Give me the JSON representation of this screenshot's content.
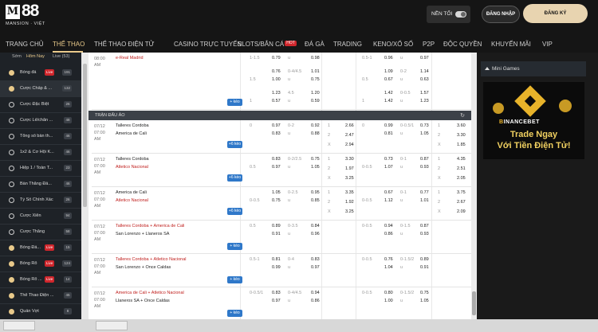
{
  "logo": {
    "mark": "M",
    "number": "88",
    "sub": "MANSION · VIỆT"
  },
  "header": {
    "night_label": "NỀN TỐI",
    "login_label": "ĐĂNG NHẬP",
    "register_label": "ĐĂNG KÝ"
  },
  "nav": {
    "items": [
      {
        "label": "TRANG CHỦ"
      },
      {
        "label": "THỂ THAO"
      },
      {
        "label": "THỂ THAO ĐIỆN TỬ"
      },
      {
        "label": "CASINO TRỰC TUYẾN"
      },
      {
        "label": "SLOTS/BẮN CÁ"
      },
      {
        "label": "ĐÁ GÀ"
      },
      {
        "label": "TRADING"
      },
      {
        "label": "KENO/XỔ SỐ"
      },
      {
        "label": "P2P"
      },
      {
        "label": "ĐỘC QUYỀN"
      },
      {
        "label": "KHUYẾN MÃI"
      },
      {
        "label": "VIP"
      }
    ],
    "hot_badge": "HOT",
    "active": "THỂ THAO"
  },
  "sidebar": {
    "tabs": [
      "Sớm",
      "Hôm Nay",
      "Live (53)"
    ],
    "items": [
      {
        "label": "Bóng đá",
        "live": "Live",
        "count": "191",
        "icon": "soccer-ball-icon"
      },
      {
        "label": "Cược Chấp & ...",
        "count": "132",
        "icon": "soccer-ball-icon"
      },
      {
        "label": "Cược Đặc Biệt",
        "count": "26",
        "icon": "circle-icon"
      },
      {
        "label": "Cược Lẻ/chẵn ...",
        "count": "48",
        "icon": "circle-icon"
      },
      {
        "label": "Tổng số bàn th...",
        "count": "46",
        "icon": "circle-icon"
      },
      {
        "label": "1x2 & Cơ Hội K...",
        "count": "46",
        "icon": "circle-icon"
      },
      {
        "label": "Hiệp 1 / Toàn T...",
        "count": "23",
        "icon": "circle-icon"
      },
      {
        "label": "Bàn Thắng Đầ...",
        "count": "46",
        "icon": "circle-icon"
      },
      {
        "label": "Tỷ Số Chính Xác",
        "count": "26",
        "icon": "circle-icon"
      },
      {
        "label": "Cược Xiên",
        "count": "94",
        "icon": "circle-icon"
      },
      {
        "label": "Cược Thắng",
        "count": "58",
        "icon": "circle-icon"
      },
      {
        "label": "Bóng Đá...",
        "live": "Live",
        "count": "15",
        "icon": "soccer-ball-icon"
      },
      {
        "label": "Bóng Rổ",
        "live": "Live",
        "count": "124",
        "icon": "basketball-icon"
      },
      {
        "label": "Bóng Rổ ...",
        "live": "Live",
        "count": "14",
        "icon": "basketball-icon"
      },
      {
        "label": "Thể Thao Điện ...",
        "count": "45",
        "icon": "esports-icon"
      },
      {
        "label": "Quần Vợt",
        "count": "8",
        "icon": "tennis-icon"
      }
    ]
  },
  "main": {
    "section_label": "TRẬN ĐẤU ẢO",
    "more_label": "+ kèo",
    "top_row": {
      "time": "08:00",
      "ampm": "AM",
      "team": "e-Real Madrid",
      "l1": [
        [
          "1-1.5",
          "0.79",
          "u",
          "0.98"
        ],
        [
          "",
          "0.76",
          "0-4/4.5",
          "1.01"
        ],
        [
          "1.5",
          "1.00",
          "u",
          "0.75"
        ],
        [
          "",
          "1.23",
          "4.5",
          "1.20"
        ],
        [
          "1",
          "0.57",
          "u",
          "0.59"
        ]
      ],
      "r1": [
        [
          "0.5-1",
          "0.96",
          "u",
          "0.97"
        ],
        [
          "",
          "1.09",
          "0-2",
          "1.14"
        ],
        [
          "0.5",
          "0.67",
          "u",
          "0.63"
        ],
        [
          "",
          "1.42",
          "0-0.5",
          "1.57"
        ],
        [
          "1",
          "1.42",
          "u",
          "1.23"
        ]
      ]
    },
    "matches": [
      {
        "date": "07/12",
        "time": "07:00",
        "ampm": "AM",
        "home": "Talleres Cordoba",
        "away": "America de Cali",
        "home_red": false,
        "away_red": false,
        "more": "+6 kèo",
        "hdp": [
          "0",
          "0.97",
          "0-2",
          "0.92"
        ],
        "hdp2": [
          "",
          "0.83",
          "u",
          "0.88"
        ],
        "x12": [
          [
            "1",
            "2.66"
          ],
          [
            "2",
            "2.47"
          ],
          [
            "X",
            "2.94"
          ]
        ],
        "hhdp": [
          "0",
          "0.99",
          "0-0.5/1",
          "0.73"
        ],
        "hhdp2": [
          "",
          "0.81",
          "u",
          "1.05"
        ],
        "hx12": [
          [
            "1",
            "3.60"
          ],
          [
            "2",
            "3.30"
          ],
          [
            "X",
            "1.85"
          ]
        ]
      },
      {
        "date": "07/12",
        "time": "07:00",
        "ampm": "AM",
        "home": "Talleres Cordoba",
        "away": "Atletico Nacional",
        "home_red": false,
        "away_red": true,
        "more": "+6 kèo",
        "hdp": [
          "",
          "0.83",
          "0-2/2.5",
          "0.75"
        ],
        "hdp2": [
          "0.5",
          "0.97",
          "u",
          "1.05"
        ],
        "x12": [
          [
            "1",
            "3.30"
          ],
          [
            "2",
            "1.97"
          ],
          [
            "X",
            "3.25"
          ]
        ],
        "hhdp": [
          "",
          "0.73",
          "0-1",
          "0.87"
        ],
        "hhdp2": [
          "0-0.5",
          "1.07",
          "u",
          "0.93"
        ],
        "hx12": [
          [
            "1",
            "4.35"
          ],
          [
            "2",
            "2.51"
          ],
          [
            "X",
            "2.05"
          ]
        ]
      },
      {
        "date": "07/12",
        "time": "07:00",
        "ampm": "AM",
        "home": "America de Cali",
        "away": "Atletico Nacional",
        "home_red": false,
        "away_red": true,
        "more": "+6 kèo",
        "hdp": [
          "",
          "1.05",
          "0-2.5",
          "0.95"
        ],
        "hdp2": [
          "0-0.5",
          "0.75",
          "u",
          "0.85"
        ],
        "x12": [
          [
            "1",
            "3.35"
          ],
          [
            "2",
            "1.92"
          ],
          [
            "X",
            "3.25"
          ]
        ],
        "hhdp": [
          "",
          "0.67",
          "0-1",
          "0.77"
        ],
        "hhdp2": [
          "0-0.5",
          "1.12",
          "u",
          "1.01"
        ],
        "hx12": [
          [
            "1",
            "3.75"
          ],
          [
            "2",
            "2.67"
          ],
          [
            "X",
            "2.09"
          ]
        ]
      },
      {
        "date": "07/12",
        "time": "07:00",
        "ampm": "AM",
        "home": "Talleres Cordoba + America de Cali",
        "away": "San Lorenzo + Llaneros SA",
        "home_red": true,
        "away_red": false,
        "more": "+ kèo",
        "hdp": [
          "0.5",
          "0.89",
          "0-3.5",
          "0.84"
        ],
        "hdp2": [
          "",
          "0.91",
          "u",
          "0.96"
        ],
        "x12": [],
        "hhdp": [
          "0-0.5",
          "0.94",
          "0-1.5",
          "0.87"
        ],
        "hhdp2": [
          "",
          "0.86",
          "u",
          "0.93"
        ],
        "hx12": []
      },
      {
        "date": "07/12",
        "time": "07:00",
        "ampm": "AM",
        "home": "Talleres Cordoba + Atletico Nacional",
        "away": "San Lorenzo + Once Caldas",
        "home_red": true,
        "away_red": false,
        "more": "+ kèo",
        "hdp": [
          "0.5-1",
          "0.81",
          "0-4",
          "0.83"
        ],
        "hdp2": [
          "",
          "0.99",
          "u",
          "0.97"
        ],
        "x12": [],
        "hhdp": [
          "0-0.5",
          "0.76",
          "0-1.5/2",
          "0.89"
        ],
        "hhdp2": [
          "",
          "1.04",
          "u",
          "0.91"
        ],
        "hx12": []
      },
      {
        "date": "07/12",
        "time": "07:00",
        "ampm": "AM",
        "home": "America de Cali + Atletico Nacional",
        "away": "Llaneros SA + Once Caldas",
        "home_red": true,
        "away_red": false,
        "more": "+ kèo",
        "hdp": [
          "0-0.5/1",
          "0.83",
          "0-4/4.5",
          "0.94"
        ],
        "hdp2": [
          "",
          "0.97",
          "u",
          "0.86"
        ],
        "x12": [],
        "hhdp": [
          "0-0.5",
          "0.80",
          "0-1.5/2",
          "0.75"
        ],
        "hhdp2": [
          "",
          "1.00",
          "u",
          "1.05"
        ],
        "hx12": []
      }
    ]
  },
  "right": {
    "mini_games_label": "Mini Games",
    "banner": {
      "brand_a": "B",
      "brand_b": "INANCEBET",
      "line1": "Trade Ngay",
      "line2": "Với Tiền Điện Tử!"
    }
  }
}
